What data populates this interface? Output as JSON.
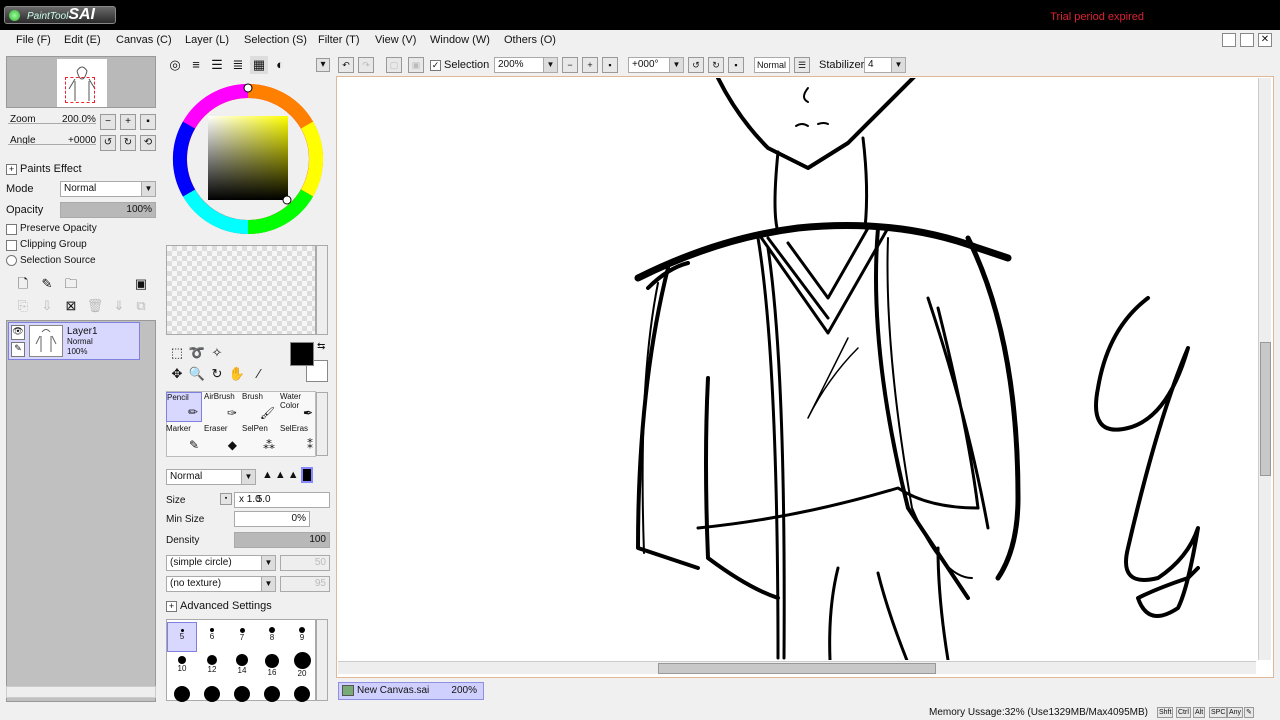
{
  "app": {
    "logo_small": "PaintTool",
    "logo_big": "SAI",
    "trial_notice": "Trial period expired"
  },
  "menu": [
    "File (F)",
    "Edit (E)",
    "Canvas (C)",
    "Layer (L)",
    "Selection (S)",
    "Filter (T)",
    "View (V)",
    "Window (W)",
    "Others (O)"
  ],
  "navigator": {
    "zoom_label": "Zoom",
    "zoom_value": "200.0%",
    "angle_label": "Angle",
    "angle_value": "+0000"
  },
  "layer_panel": {
    "paints_effect": "Paints Effect",
    "mode_label": "Mode",
    "mode_value": "Normal",
    "opacity_label": "Opacity",
    "opacity_value": "100%",
    "opacity_fraction": 1.0,
    "preserve_opacity": "Preserve Opacity",
    "clipping_group": "Clipping Group",
    "selection_source": "Selection Source",
    "layers": [
      {
        "name": "Layer1",
        "mode": "Normal",
        "opacity": "100%"
      }
    ]
  },
  "tools": {
    "brushes": [
      {
        "label": "Pencil",
        "icon": "pencil-icon"
      },
      {
        "label": "AirBrush",
        "icon": "airbrush-icon"
      },
      {
        "label": "Brush",
        "icon": "brush-icon"
      },
      {
        "label": "Water Color",
        "icon": "watercolor-icon"
      },
      {
        "label": "Marker",
        "icon": "marker-icon"
      },
      {
        "label": "Eraser",
        "icon": "eraser-icon"
      },
      {
        "label": "SelPen",
        "icon": "selpen-icon"
      },
      {
        "label": "SelEras",
        "icon": "seleras-icon"
      }
    ],
    "blend_mode": "Normal",
    "size_label": "Size",
    "size_multiplier": "x 1.0",
    "size_value": "5.0",
    "min_size_label": "Min Size",
    "min_size_value": "0%",
    "density_label": "Density",
    "density_value": "100",
    "density_fraction": 1.0,
    "shape": "(simple circle)",
    "shape_value": "50",
    "texture": "(no texture)",
    "texture_value": "95",
    "advanced_settings": "Advanced Settings",
    "brush_sizes": [
      "5",
      "6",
      "7",
      "8",
      "9",
      "10",
      "12",
      "14",
      "16",
      "20"
    ]
  },
  "toolbar": {
    "selection_label": "Selection",
    "zoom": "200%",
    "angle": "+000°",
    "mode": "Normal",
    "stabilizer_label": "Stabilizer",
    "stabilizer_value": "4"
  },
  "document_tab": {
    "name": "New Canvas.sai",
    "zoom": "200%"
  },
  "status": {
    "memory": "Memory Ussage:32% (Use1329MB/Max4095MB)",
    "keys": [
      "Shft",
      "Ctrl",
      "Alt",
      "SPC",
      "Any"
    ]
  },
  "colors": {
    "primary": "#000000",
    "secondary": "#ffffff",
    "accent": "#d8d8ff"
  }
}
